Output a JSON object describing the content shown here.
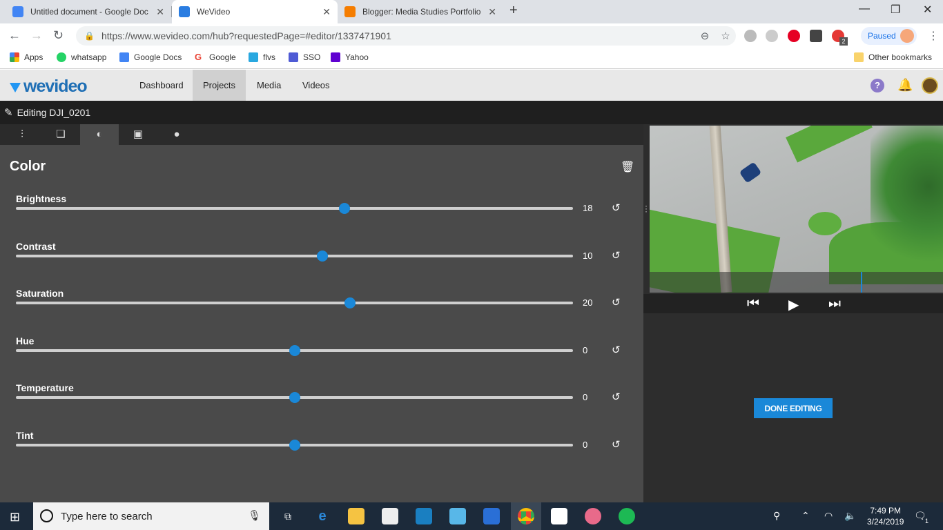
{
  "browser": {
    "tabs": [
      {
        "title": "Untitled document - Google Doc",
        "icon": "google-docs-icon",
        "color": "#4285f4"
      },
      {
        "title": "WeVideo",
        "icon": "wevideo-icon",
        "color": "#2a7de1"
      },
      {
        "title": "Blogger: Media Studies Portfolio",
        "icon": "blogger-icon",
        "color": "#f57d00"
      }
    ],
    "url": "https://www.wevideo.com/hub?requestedPage=#editor/1337471901",
    "profile_status": "Paused",
    "extension_badge": "2",
    "bookmarks": [
      {
        "label": "Apps",
        "icon": "apps-grid-icon",
        "color": "#ea4335"
      },
      {
        "label": "whatsapp",
        "icon": "whatsapp-icon",
        "color": "#25d366"
      },
      {
        "label": "Google Docs",
        "icon": "google-docs-icon",
        "color": "#4285f4"
      },
      {
        "label": "Google",
        "icon": "google-icon",
        "color": "#ea4335"
      },
      {
        "label": "flvs",
        "icon": "flvs-icon",
        "color": "#29a8e0"
      },
      {
        "label": "SSO",
        "icon": "sso-icon",
        "color": "#4f5bd5"
      },
      {
        "label": "Yahoo",
        "icon": "yahoo-icon",
        "color": "#5f01d1"
      }
    ],
    "other_bookmarks": "Other bookmarks"
  },
  "app": {
    "logo": "wevideo",
    "nav": [
      "Dashboard",
      "Projects",
      "Media",
      "Videos"
    ],
    "active_nav": "Projects",
    "editing_title": "Editing DJI_0201"
  },
  "color_panel": {
    "title": "Color",
    "sliders": [
      {
        "label": "Brightness",
        "value": "18",
        "fraction": 0.59
      },
      {
        "label": "Contrast",
        "value": "10",
        "fraction": 0.55
      },
      {
        "label": "Saturation",
        "value": "20",
        "fraction": 0.6
      },
      {
        "label": "Hue",
        "value": "0",
        "fraction": 0.5
      },
      {
        "label": "Temperature",
        "value": "0",
        "fraction": 0.5
      },
      {
        "label": "Tint",
        "value": "0",
        "fraction": 0.5
      }
    ]
  },
  "preview": {
    "done_label": "DONE EDITING",
    "playhead_fraction": 0.72
  },
  "taskbar": {
    "search_placeholder": "Type here to search",
    "time": "7:49 PM",
    "date": "3/24/2019",
    "notification_count": "1"
  },
  "colors": {
    "accent": "#1a88d8",
    "panel_bg": "#4a4a4a",
    "header_bg": "#e8e8e8"
  }
}
